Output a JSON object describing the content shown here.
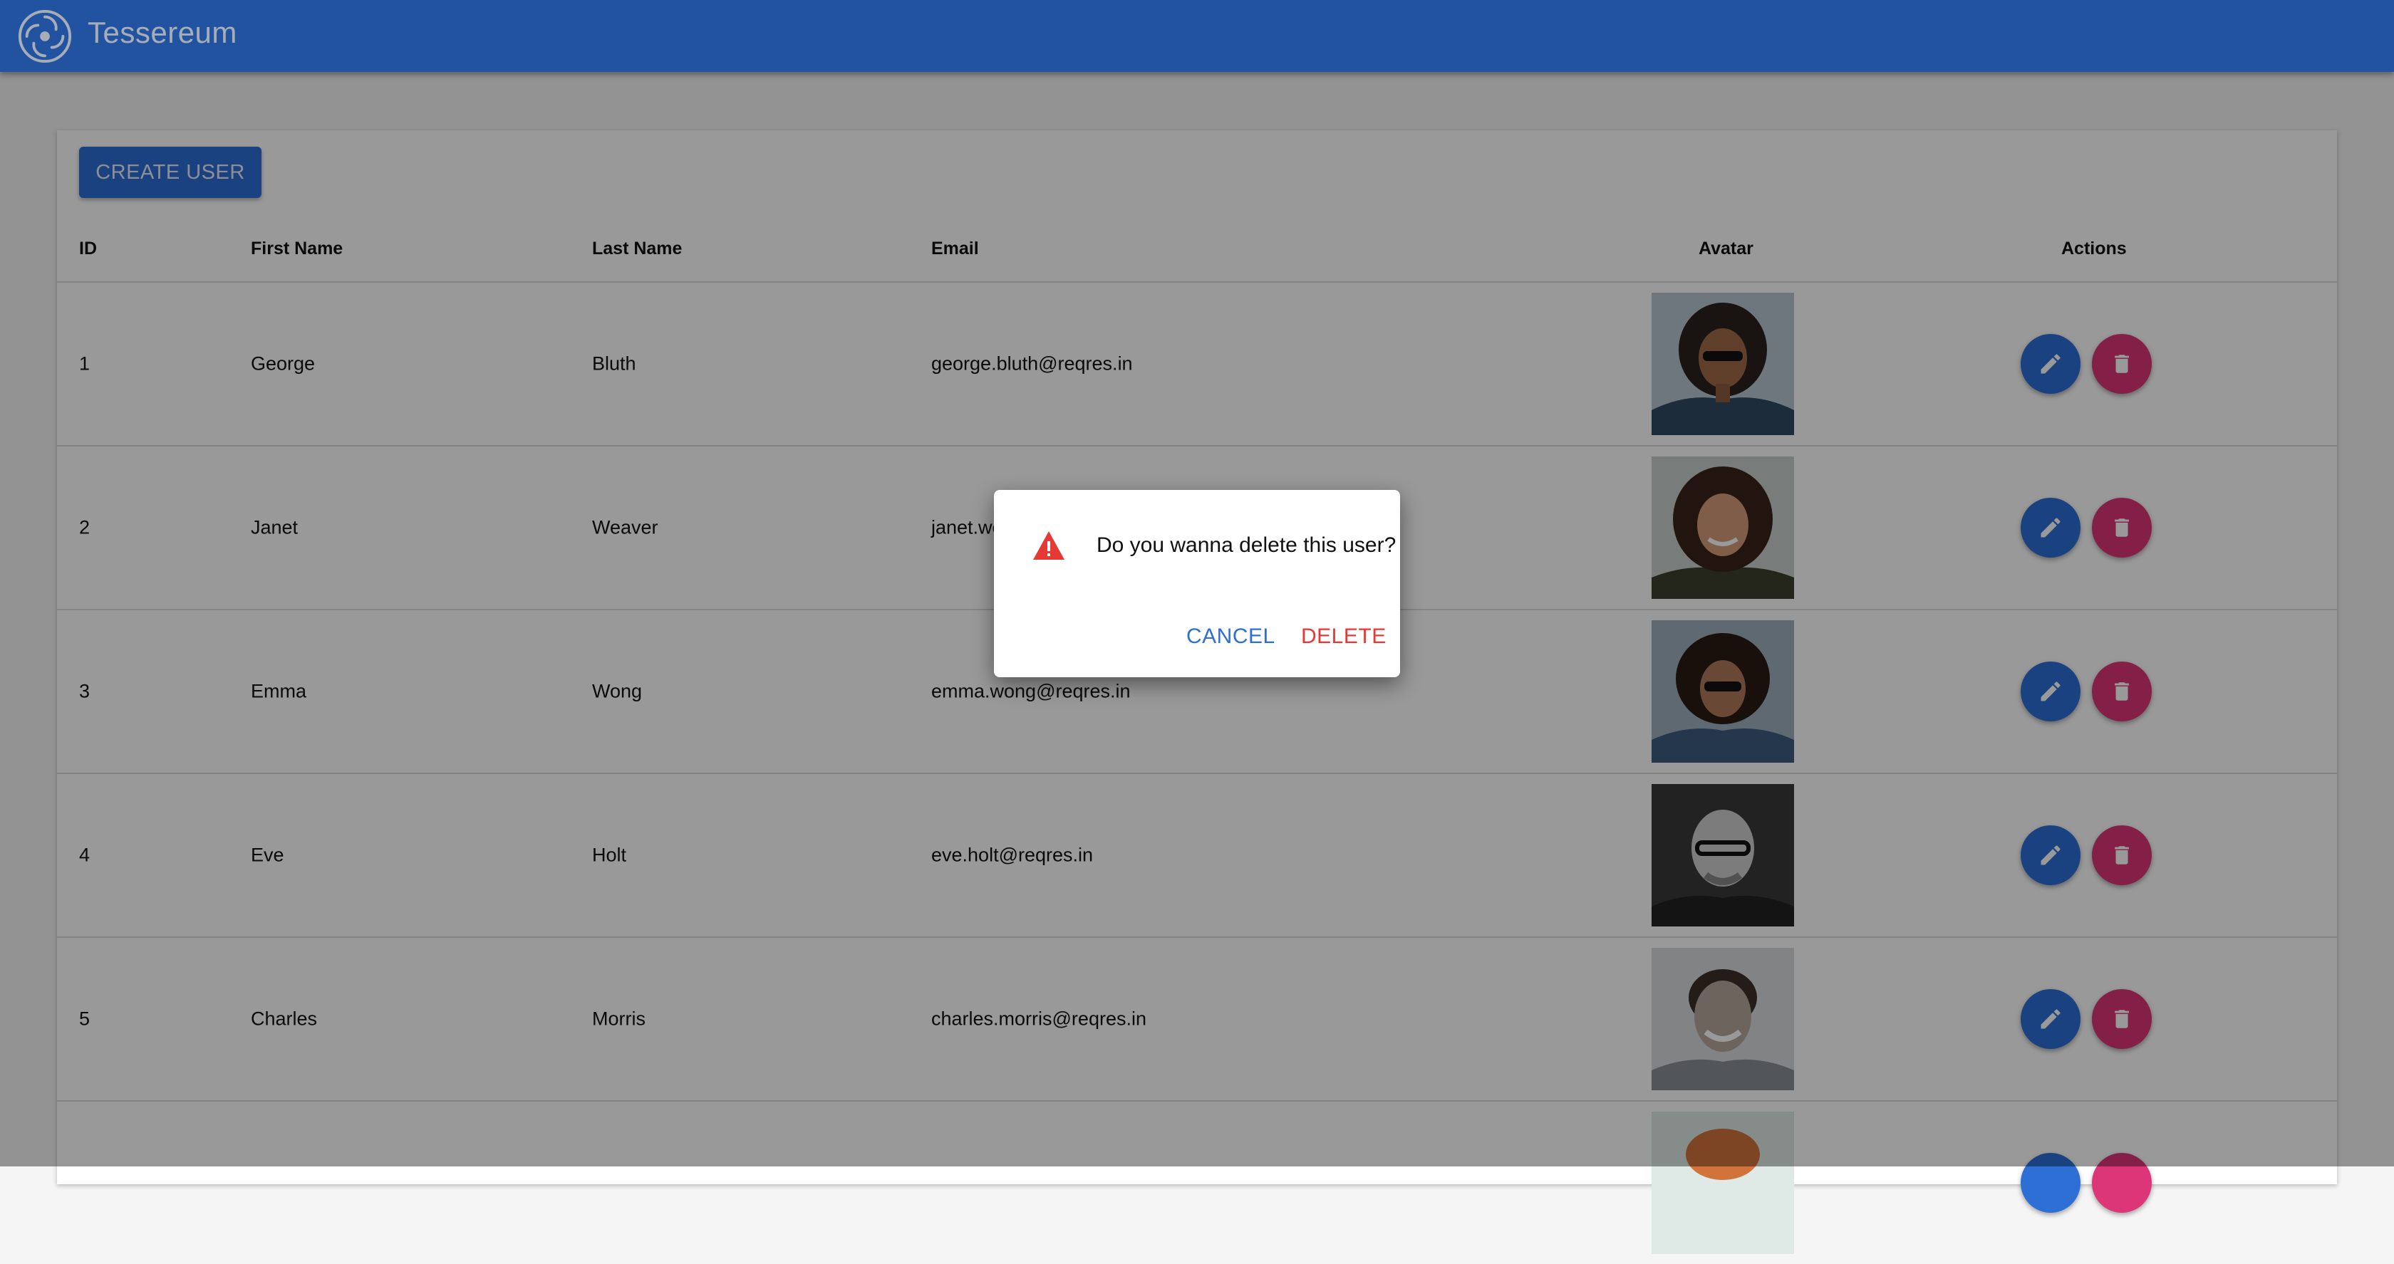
{
  "app": {
    "title": "Tessereum"
  },
  "toolbar": {
    "create_label": "CREATE USER"
  },
  "table": {
    "headers": [
      "ID",
      "First Name",
      "Last Name",
      "Email",
      "Avatar",
      "Actions"
    ],
    "rows": [
      {
        "id": "1",
        "first": "George",
        "last": "Bluth",
        "email": "george.bluth@reqres.in"
      },
      {
        "id": "2",
        "first": "Janet",
        "last": "Weaver",
        "email": "janet.weaver@reqres.in"
      },
      {
        "id": "3",
        "first": "Emma",
        "last": "Wong",
        "email": "emma.wong@reqres.in"
      },
      {
        "id": "4",
        "first": "Eve",
        "last": "Holt",
        "email": "eve.holt@reqres.in"
      },
      {
        "id": "5",
        "first": "Charles",
        "last": "Morris",
        "email": "charles.morris@reqres.in"
      }
    ]
  },
  "dialog": {
    "message": "Do you wanna delete this user?",
    "cancel_label": "CANCEL",
    "delete_label": "DELETE",
    "icon": "warning-icon"
  },
  "colors": {
    "primary": "#2e6fd6",
    "danger": "#dc3578",
    "dialog_delete": "#e53935",
    "backdrop": "rgba(0,0,0,0.4)"
  }
}
